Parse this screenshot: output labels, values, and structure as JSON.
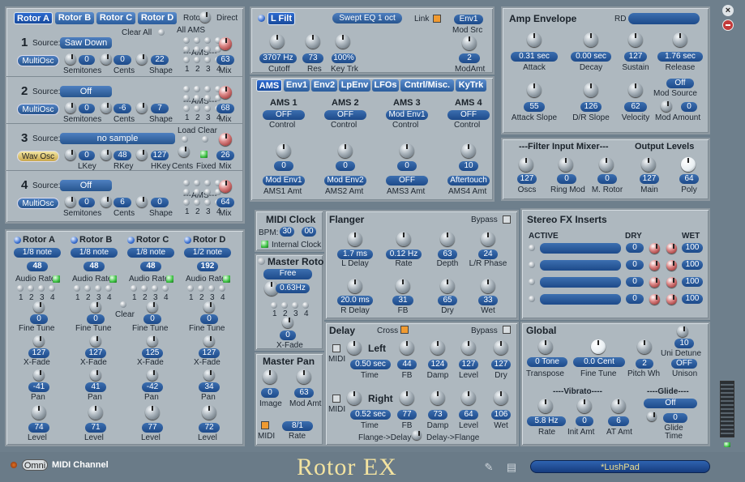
{
  "rotor_tabs": [
    "Rotor A",
    "Rotor B",
    "Rotor C",
    "Rotor D"
  ],
  "top": {
    "rotor_lbl": "Rotor",
    "direct_lbl": "Direct",
    "clear_all": "Clear All",
    "all_ams": "All AMS"
  },
  "osc1": {
    "num": "1",
    "src_lbl": "Source:",
    "source": "Saw Down",
    "type": "MultiOsc",
    "semitones": "0",
    "cents": "0",
    "shape": "22",
    "mix": "63",
    "l_semi": "Semitones",
    "l_cents": "Cents",
    "l_shape": "Shape",
    "l_mix": "Mix",
    "ams": "---AMS---",
    "amsn": [
      "1",
      "2",
      "3",
      "4"
    ]
  },
  "osc2": {
    "num": "2",
    "src_lbl": "Source:",
    "source": "Off",
    "type": "MultiOsc",
    "semitones": "0",
    "cents": "-6",
    "shape": "7",
    "mix": "68",
    "l_semi": "Semitones",
    "l_cents": "Cents",
    "l_shape": "Shape",
    "l_mix": "Mix",
    "ams": "---AMS---",
    "amsn": [
      "1",
      "2",
      "3",
      "4"
    ]
  },
  "osc3": {
    "num": "3",
    "src_lbl": "Source:",
    "source": "no sample",
    "type": "Wav Osc",
    "lkey": "0",
    "rkey": "48",
    "hkey": "127",
    "mix": "26",
    "l_lkey": "LKey",
    "l_rkey": "RKey",
    "l_hkey": "HKey",
    "l_cents": "Cents",
    "l_fixed": "Fixed",
    "l_mix": "Mix",
    "load": "Load",
    "clear": "Clear"
  },
  "osc4": {
    "num": "4",
    "src_lbl": "Source:",
    "source": "Off",
    "type": "MultiOsc",
    "semitones": "0",
    "cents": "6",
    "shape": "0",
    "mix": "64",
    "l_semi": "Semitones",
    "l_cents": "Cents",
    "l_shape": "Shape",
    "l_mix": "Mix",
    "ams": "---AMS---",
    "amsn": [
      "1",
      "2",
      "3",
      "4"
    ]
  },
  "rotors": [
    {
      "name": "Rotor A",
      "rate": "1/8 note",
      "num": "48",
      "fine": "0",
      "xfade": "127",
      "pan": "-41",
      "level": "74"
    },
    {
      "name": "Rotor B",
      "rate": "1/8 note",
      "num": "48",
      "fine": "0",
      "xfade": "127",
      "pan": "41",
      "level": "71"
    },
    {
      "name": "Rotor C",
      "rate": "1/8 note",
      "num": "48",
      "fine": "0",
      "xfade": "125",
      "pan": "-42",
      "level": "77"
    },
    {
      "name": "Rotor D",
      "rate": "1/2 note",
      "num": "192",
      "fine": "0",
      "xfade": "127",
      "pan": "34",
      "level": "72"
    }
  ],
  "rotor_lbls": {
    "audio_rate": "Audio Rate",
    "fine_tune": "Fine Tune",
    "xfade": "X-Fade",
    "pan": "Pan",
    "level": "Level",
    "clear": "Clear",
    "nums": [
      "1",
      "2",
      "3",
      "4"
    ]
  },
  "filter": {
    "title": "L Filt",
    "type": "Swept EQ 1 oct",
    "link": "Link",
    "env": "Env1",
    "mod_src": "Mod Src",
    "cutoff": "3707 Hz",
    "res": "73",
    "keytrk": "100%",
    "modamt": "2",
    "l_cutoff": "Cutoff",
    "l_res": "Res",
    "l_keytrk": "Key Trk",
    "l_modamt": "ModAmt"
  },
  "mod_tabs": [
    "AMS",
    "Env1",
    "Env2",
    "LpEnv",
    "LFOs",
    "Cntrl/Misc.",
    "KyTrk"
  ],
  "ams": [
    {
      "title": "AMS 1",
      "ctrl": "OFF",
      "amt": "0",
      "src": "Mod Env1",
      "amt_lbl": "AMS1 Amt"
    },
    {
      "title": "AMS 2",
      "ctrl": "OFF",
      "amt": "0",
      "src": "Mod Env2",
      "amt_lbl": "AMS2 Amt"
    },
    {
      "title": "AMS 3",
      "ctrl": "Mod Env1",
      "amt": "0",
      "src": "OFF",
      "amt_lbl": "AMS3 Amt"
    },
    {
      "title": "AMS 4",
      "ctrl": "OFF",
      "amt": "10",
      "src": "Aftertouch",
      "amt_lbl": "AMS4 Amt"
    }
  ],
  "ams_ctrl_lbl": "Control",
  "amp": {
    "title": "Amp Envelope",
    "rd": "RD",
    "attack": "0.31 sec",
    "decay": "0.00 sec",
    "sustain": "127",
    "release": "1.76 sec",
    "att_slope": "55",
    "dr_slope": "126",
    "velocity": "62",
    "mod_src": "Off",
    "mod_amt": "0",
    "l_attack": "Attack",
    "l_decay": "Decay",
    "l_sustain": "Sustain",
    "l_release": "Release",
    "l_att_slope": "Attack Slope",
    "l_dr_slope": "D/R Slope",
    "l_velocity": "Velocity",
    "l_mod_src": "Mod Source",
    "l_mod_amt": "Mod Amount"
  },
  "mixer": {
    "title": "---Filter Input Mixer---",
    "out_title": "Output Levels",
    "oscs": "127",
    "ringmod": "0",
    "mrotor": "0",
    "main": "127",
    "poly": "64",
    "l_oscs": "Oscs",
    "l_ringmod": "Ring Mod",
    "l_mrotor": "M. Rotor",
    "l_main": "Main",
    "l_poly": "Poly"
  },
  "midi_clock": {
    "title": "MIDI Clock",
    "bpm_lbl": "BPM:",
    "bpm": "30",
    "bpm2": "00",
    "internal": "Internal Clock"
  },
  "master_rotor": {
    "title": "Master Rotor",
    "mode": "Free",
    "rate": "0.63Hz",
    "xfade": "0",
    "l_xfade": "X-Fade",
    "nums": [
      "1",
      "2",
      "3",
      "4"
    ]
  },
  "master_pan": {
    "title": "Master Pan",
    "image": "0",
    "modamt": "63",
    "rate": "8/1",
    "l_image": "Image",
    "l_modamt": "Mod Amt",
    "l_midi": "MIDI",
    "l_rate": "Rate"
  },
  "flanger": {
    "title": "Flanger",
    "bypass": "Bypass",
    "ldelay": "1.7 ms",
    "rate": "0.12 Hz",
    "depth": "63",
    "lrphase": "24",
    "rdelay": "20.0 ms",
    "fb": "31",
    "dry": "65",
    "wet": "33",
    "l_ldelay": "L Delay",
    "l_rate": "Rate",
    "l_depth": "Depth",
    "l_lrphase": "L/R Phase",
    "l_rdelay": "R Delay",
    "l_fb": "FB",
    "l_dry": "Dry",
    "l_wet": "Wet"
  },
  "delay": {
    "title": "Delay",
    "cross": "Cross",
    "bypass": "Bypass",
    "left": "Left",
    "right": "Right",
    "l_midi": "MIDI",
    "ltime": "0.50 sec",
    "lfb": "44",
    "ldamp": "124",
    "llevel": "127",
    "ldry": "127",
    "rtime": "0.52 sec",
    "rfb": "77",
    "rdamp": "73",
    "rlevel": "64",
    "rwet": "106",
    "l_time": "Time",
    "l_fb": "FB",
    "l_damp": "Damp",
    "l_level": "Level",
    "l_dry": "Dry",
    "l_wet": "Wet",
    "flange_delay": "Flange->Delay",
    "delay_flange": "Delay->Flange"
  },
  "fx": {
    "title": "Stereo FX Inserts",
    "active": "ACTIVE",
    "dry": "DRY",
    "wet": "WET",
    "rows": [
      {
        "dry": "0",
        "wet": "100"
      },
      {
        "dry": "0",
        "wet": "100"
      },
      {
        "dry": "0",
        "wet": "100"
      },
      {
        "dry": "0",
        "wet": "100"
      }
    ]
  },
  "global": {
    "title": "Global",
    "transpose": "0 Tone",
    "finetune": "0.0 Cent",
    "pitchwh": "2",
    "unidetune": "10",
    "unison": "OFF",
    "l_transpose": "Transpose",
    "l_finetune": "Fine Tune",
    "l_pitchwh": "Pitch Wh",
    "l_unidetune": "Uni Detune",
    "l_unison": "Unison",
    "vibrato": "----Vibrato----",
    "glide": "----Glide----",
    "vrate": "5.8 Hz",
    "initamt": "0",
    "atamt": "6",
    "glide_mode": "Off",
    "glide_time": "0",
    "l_vrate": "Rate",
    "l_initamt": "Init Amt",
    "l_atamt": "AT Amt",
    "l_glide_time": "Glide Time"
  },
  "footer": {
    "omni": "Omni",
    "midi_channel": "MIDI Channel",
    "logo": "Rotor EX",
    "preset": "*LushPad"
  },
  "colors": {
    "bg": "#6e7f8c",
    "panel": "#aeb8bf",
    "value": "#2d5fa6",
    "accent": "#f09a30"
  }
}
